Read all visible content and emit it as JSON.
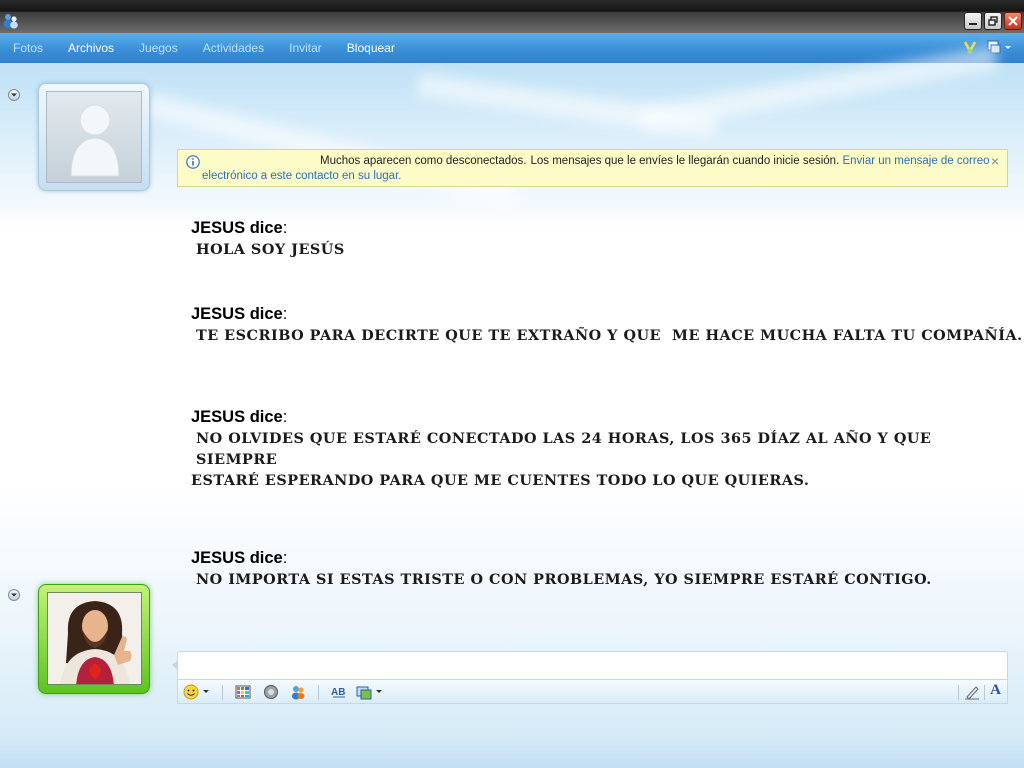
{
  "window": {
    "logo_icon": "messenger-logo-icon",
    "minimize_icon": "minimize-icon",
    "maximize_icon": "restore-icon",
    "close_icon": "close-icon"
  },
  "menu": {
    "items": [
      {
        "label": "Fotos",
        "active": false
      },
      {
        "label": "Archivos",
        "active": true
      },
      {
        "label": "Juegos",
        "active": false
      },
      {
        "label": "Actividades",
        "active": false
      },
      {
        "label": "Invitar",
        "active": false
      },
      {
        "label": "Bloquear",
        "active": true
      }
    ],
    "right_icons": [
      "wink-icon",
      "display-options-icon"
    ]
  },
  "notice": {
    "icon": "info-icon",
    "text_part1": "Muchos aparecen como desconectados.",
    "text_part2": "Los mensajes que le envíes le llegarán cuando inicie sesión.",
    "link_part1": "Enviar un mensaje de correo",
    "link_part2": "electrónico a este contacto en su lugar.",
    "close_label": "×"
  },
  "messages": [
    {
      "sender": "JESUS dice",
      "colon": ":",
      "lines": [
        "HOLA SOY JESÚS"
      ]
    },
    {
      "sender": "JESUS dice",
      "colon": ":",
      "lines": [
        "TE ESCRIBO PARA DECIRTE QUE TE EXTRAÑO Y QUE  ME HACE MUCHA FALTA TU COMPAÑÍA."
      ]
    },
    {
      "sender": "JESUS dice",
      "colon": ":",
      "lines": [
        "NO OLVIDES QUE ESTARÉ CONECTADO LAS 24 HORAS, LOS 365 DÍAZ AL AÑO Y QUE SIEMPRE",
        "ESTARÉ ESPERANDO PARA QUE ME CUENTES TODO LO QUE QUIERAS."
      ]
    },
    {
      "sender": "JESUS dice",
      "colon": ":",
      "lines": [
        "NO IMPORTA SI ESTAS TRISTE O CON PROBLEMAS, YO SIEMPRE ESTARÉ CONTIGO."
      ]
    }
  ],
  "toolbar": {
    "icons": [
      "emoticon-icon",
      "background-icon",
      "nudge-icon",
      "wink-icon",
      "spellcheck-icon",
      "share-picture-icon",
      "handwriting-icon",
      "font-icon"
    ],
    "font_label": "A"
  },
  "colors": {
    "menubar": "#3a8fd9",
    "notice_bg": "#fdfcc8",
    "link": "#2a6fb8",
    "contact_frame": "#5cc422"
  }
}
